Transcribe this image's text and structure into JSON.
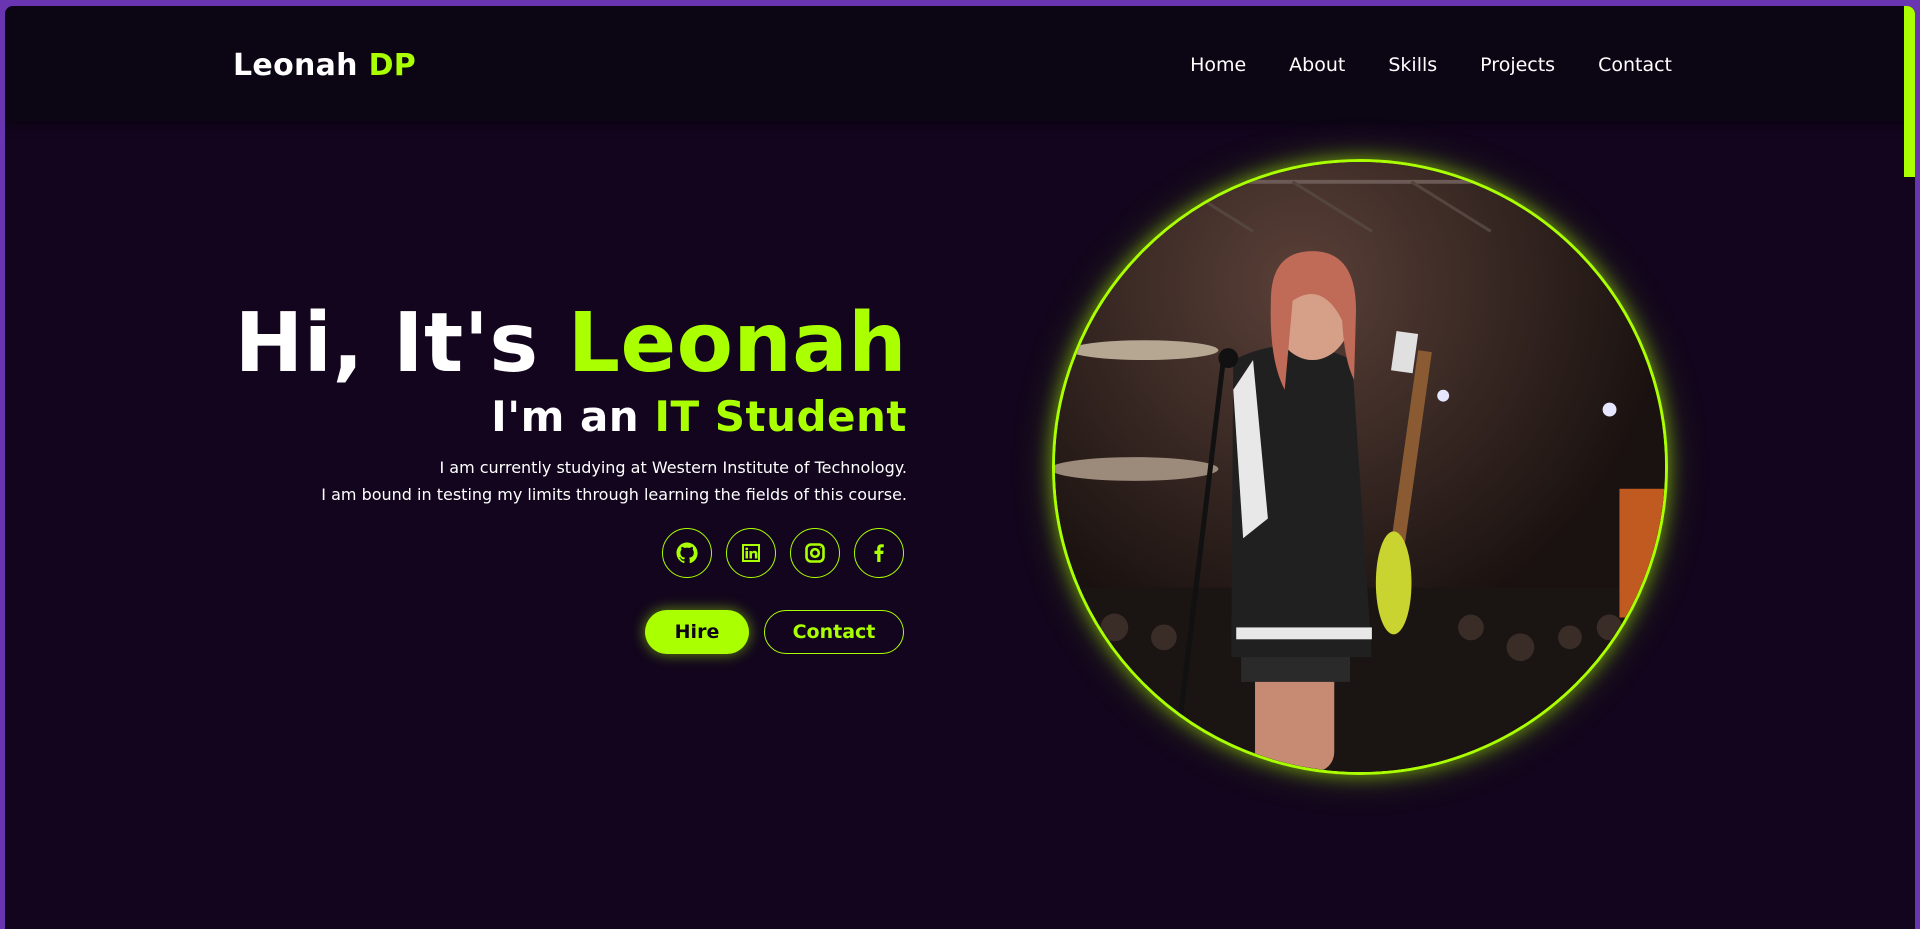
{
  "colors": {
    "accent": "#aaff00",
    "background": "#12051d",
    "navbar": "#0b0514",
    "window_border": "#6a35b0"
  },
  "logo": {
    "name": "Leonah",
    "accent": "DP"
  },
  "nav": [
    {
      "label": "Home"
    },
    {
      "label": "About"
    },
    {
      "label": "Skills"
    },
    {
      "label": "Projects"
    },
    {
      "label": "Contact"
    }
  ],
  "hero": {
    "greeting_prefix": "Hi, It's",
    "greeting_name": "Leonah",
    "role_prefix": "I'm an",
    "role_accent": "IT Student",
    "description": [
      "I am currently studying at Western Institute of Technology.",
      "I am bound in testing my limits through learning the fields of this course."
    ]
  },
  "socials": [
    {
      "icon": "github-icon"
    },
    {
      "icon": "linkedin-icon"
    },
    {
      "icon": "instagram-icon"
    },
    {
      "icon": "facebook-icon"
    }
  ],
  "buttons": {
    "hire": "Hire",
    "contact": "Contact"
  },
  "photo": {
    "icon": "profile-photo"
  }
}
